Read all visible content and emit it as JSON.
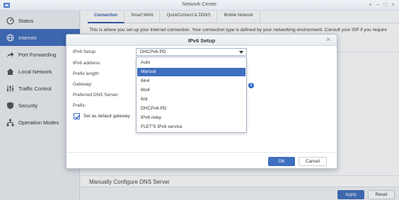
{
  "window": {
    "title": "Network Center",
    "controls": [
      "+",
      "–",
      "□",
      "×"
    ]
  },
  "sidebar": {
    "items": [
      {
        "label": "Status",
        "icon": "status-icon",
        "active": false
      },
      {
        "label": "Internet",
        "icon": "globe-icon",
        "active": true
      },
      {
        "label": "Port Forwarding",
        "icon": "share-icon",
        "active": false
      },
      {
        "label": "Local Network",
        "icon": "home-icon",
        "active": false
      },
      {
        "label": "Traffic Control",
        "icon": "sliders-icon",
        "active": false
      },
      {
        "label": "Security",
        "icon": "shield-icon",
        "active": false
      },
      {
        "label": "Operation Modes",
        "icon": "network-icon",
        "active": false
      }
    ]
  },
  "main": {
    "tabs": [
      {
        "label": "Connection",
        "active": true
      },
      {
        "label": "Smart WAN",
        "active": false
      },
      {
        "label": "QuickConnect & DDNS",
        "active": false
      },
      {
        "label": "Mobile Network",
        "active": false
      }
    ],
    "description": "This is where you set up your Internet connection. Your connection type is defined by your networking environment. Consult your ISP if you require",
    "section_heading": "Manually Configure DNS Server",
    "apply_label": "Apply",
    "reset_label": "Reset"
  },
  "modal": {
    "title": "IPv6 Setup",
    "fields": {
      "ipv6_setup": "IPv6 Setup:",
      "ipv6_address": "IPv6 address:",
      "prefix_length": "Prefix length:",
      "gateway": "Gateway:",
      "preferred_dns": "Preferred DNS Server:",
      "prefix": "Prefix:"
    },
    "select_value": "DHCPv6-PD",
    "options": [
      "Auto",
      "Manual",
      "6in4",
      "6to4",
      "6rd",
      "DHCPv6-PD",
      "IPv6 relay",
      "FLET'S IPv6 service"
    ],
    "highlighted_option": "Manual",
    "default_gateway_label": "Set as default gateway",
    "default_gateway_checked": true,
    "ok_label": "OK",
    "cancel_label": "Cancel"
  },
  "colors": {
    "accent": "#3f6fbf",
    "info": "#2f6ad0"
  }
}
